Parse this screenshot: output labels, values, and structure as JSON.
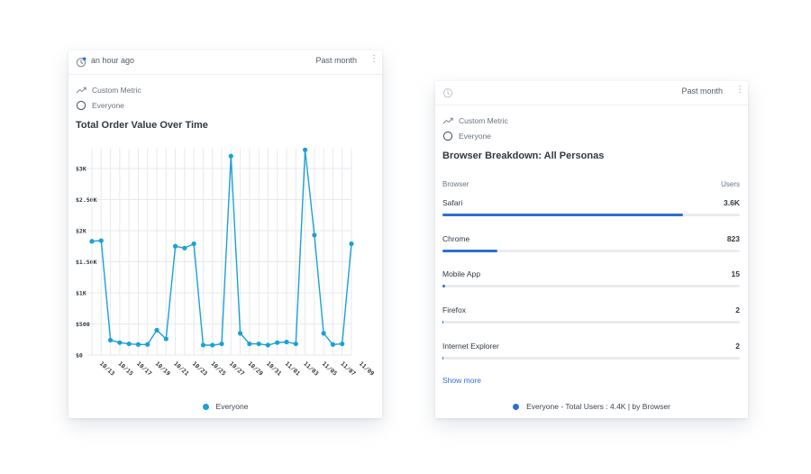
{
  "left_card": {
    "updated": "an hour ago",
    "range": "Past month",
    "menu_icon": "kebab-menu-icon",
    "metric_type": "Custom Metric",
    "segment": "Everyone",
    "title": "Total Order Value Over Time",
    "legend_label": "Everyone"
  },
  "right_card": {
    "range": "Past month",
    "metric_type": "Custom Metric",
    "segment": "Everyone",
    "title": "Browser Breakdown: All Personas",
    "col_browser": "Browser",
    "col_users": "Users",
    "rows": [
      {
        "label": "Safari",
        "value": "3.6K",
        "share": 0.81
      },
      {
        "label": "Chrome",
        "value": "823",
        "share": 0.185
      },
      {
        "label": "Mobile App",
        "value": "15",
        "share": 0.008
      },
      {
        "label": "Firefox",
        "value": "2",
        "share": 0.004
      },
      {
        "label": "Internet Explorer",
        "value": "2",
        "share": 0.004
      }
    ],
    "show_more": "Show more",
    "footer_legend": "Everyone - Total Users : 4.4K | by Browser"
  },
  "colors": {
    "line": "#1aa0d9",
    "bar": "#2d6fd1",
    "legend_dot_left": "#1aa0d9",
    "legend_dot_right": "#2d6fd1"
  },
  "chart_data": {
    "type": "line",
    "title": "Total Order Value Over Time",
    "xlabel": "",
    "ylabel": "",
    "ylim": [
      0,
      3000
    ],
    "y_ticks": [
      "$0",
      "$500",
      "$1K",
      "$1.50K",
      "$2K",
      "$2.50K",
      "$3K"
    ],
    "y_tick_values": [
      0,
      500,
      1000,
      1500,
      2000,
      2500,
      3000
    ],
    "x_tick_labels": [
      "10/13",
      "10/15",
      "10/17",
      "10/19",
      "10/21",
      "10/23",
      "10/25",
      "10/27",
      "10/29",
      "10/31",
      "11/01",
      "11/03",
      "11/05",
      "11/07",
      "11/09"
    ],
    "grid": true,
    "legend": "bottom-center",
    "series": [
      {
        "name": "Everyone",
        "x": [
          "10/12",
          "10/13",
          "10/14",
          "10/15",
          "10/16",
          "10/17",
          "10/18",
          "10/19",
          "10/20",
          "10/21",
          "10/22",
          "10/23",
          "10/24",
          "10/25",
          "10/26",
          "10/27",
          "10/28",
          "10/29",
          "10/30",
          "10/31",
          "11/01",
          "11/02",
          "11/03",
          "11/04",
          "11/05",
          "11/06",
          "11/07",
          "11/08",
          "11/09"
        ],
        "values": [
          1830,
          1840,
          240,
          200,
          180,
          170,
          170,
          400,
          260,
          1750,
          1720,
          1790,
          160,
          160,
          180,
          3200,
          350,
          180,
          180,
          160,
          200,
          210,
          180,
          3300,
          1930,
          350,
          170,
          180,
          1790
        ]
      }
    ]
  }
}
